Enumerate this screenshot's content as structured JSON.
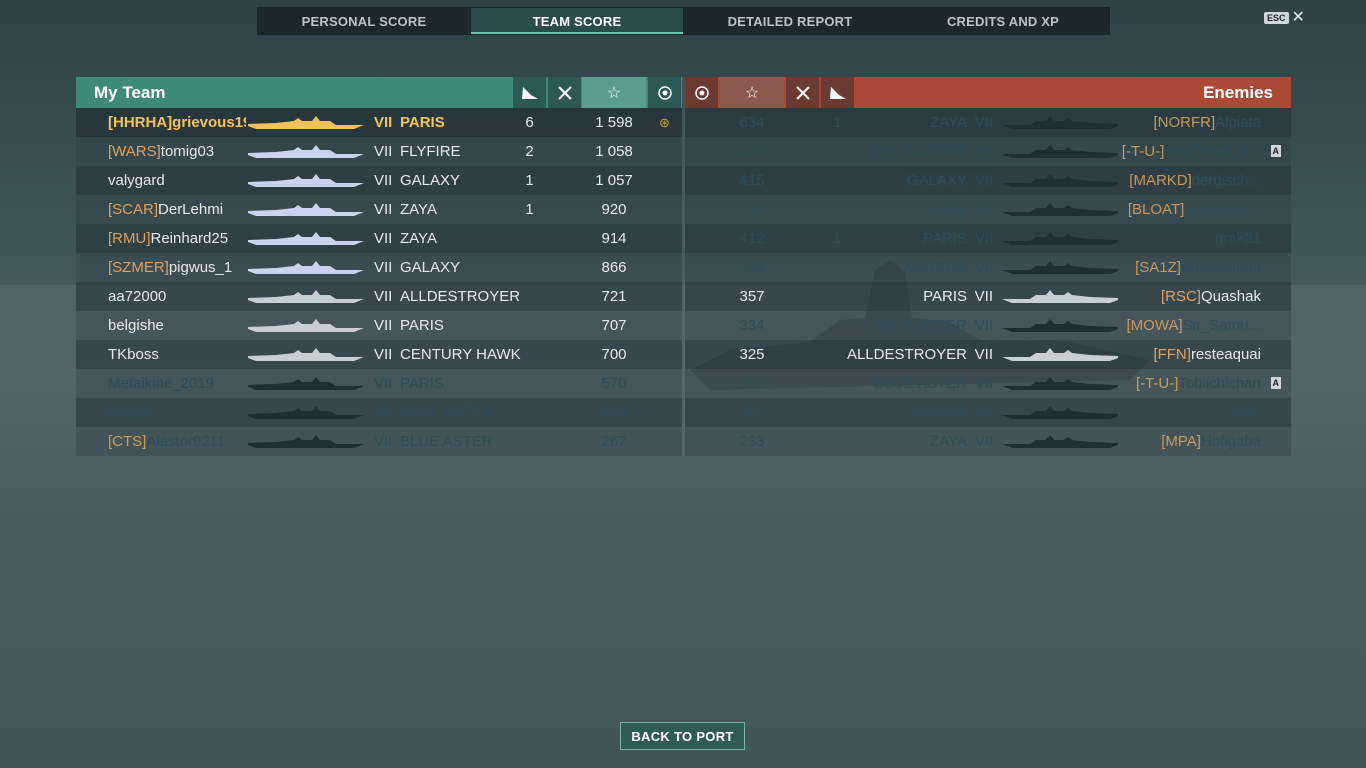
{
  "tabs": [
    "PERSONAL SCORE",
    "TEAM SCORE",
    "DETAILED REPORT",
    "CREDITS AND XP"
  ],
  "active_tab": 1,
  "esc_label": "ESC",
  "my_team": {
    "title": "My Team",
    "players": [
      {
        "clan": "[HHRHA]",
        "name": "grievous19...",
        "tier": "VII",
        "ship": "PARIS",
        "kills": "6",
        "exp": "1 598",
        "me": true
      },
      {
        "clan": "[WARS]",
        "name": "tomig03",
        "tier": "VII",
        "ship": "FLYFIRE",
        "kills": "2",
        "exp": "1 058"
      },
      {
        "clan": "",
        "name": "valygard",
        "tier": "VII",
        "ship": "GALAXY",
        "kills": "1",
        "exp": "1 057"
      },
      {
        "clan": "[SCAR]",
        "name": "DerLehmi",
        "tier": "VII",
        "ship": "ZAYA",
        "kills": "1",
        "exp": "920"
      },
      {
        "clan": "[RMU]",
        "name": "Reinhard25",
        "tier": "VII",
        "ship": "ZAYA",
        "kills": "",
        "exp": "914"
      },
      {
        "clan": "[SZMER]",
        "name": "pigwus_1",
        "tier": "VII",
        "ship": "GALAXY",
        "kills": "",
        "exp": "866"
      },
      {
        "clan": "",
        "name": "aa72000",
        "tier": "VII",
        "ship": "ALLDESTROYER",
        "kills": "",
        "exp": "721"
      },
      {
        "clan": "",
        "name": "belgishe",
        "tier": "VII",
        "ship": "PARIS",
        "kills": "",
        "exp": "707"
      },
      {
        "clan": "",
        "name": "TKboss",
        "tier": "VII",
        "ship": "CENTURY HAWK",
        "kills": "",
        "exp": "700"
      },
      {
        "clan": "",
        "name": "Metalkine_2019",
        "tier": "VII",
        "ship": "PARIS",
        "kills": "",
        "exp": "570",
        "dead": true
      },
      {
        "clan": "",
        "name": "Ptikipik",
        "tier": "VII",
        "ship": "BLUE ASTER",
        "kills": "",
        "exp": "403",
        "dead": true
      },
      {
        "clan": "[CTS]",
        "name": "Alastor9211",
        "tier": "VII",
        "ship": "BLUE ASTER",
        "kills": "",
        "exp": "267",
        "dead": true
      }
    ]
  },
  "enemies": {
    "title": "Enemies",
    "players": [
      {
        "exp": "634",
        "kills": "1",
        "ship": "ZAYA",
        "tier": "VII",
        "clan": "[NORFR]",
        "name": "Alpiata",
        "dead": true
      },
      {
        "exp": "460",
        "kills": "1",
        "ship": "BLUE ASTER",
        "tier": "VII",
        "clan": "[-T-U-]",
        "name": "BoyOfHell_1...",
        "dead": true,
        "badge": "A"
      },
      {
        "exp": "415",
        "kills": "",
        "ship": "GALAXY",
        "tier": "VII",
        "clan": "[MARKD]",
        "name": "dergisch...",
        "dead": true
      },
      {
        "exp": "414",
        "kills": "",
        "ship": "PARIS",
        "tier": "VII",
        "clan": "[BLOAT]",
        "name": "Supersho...",
        "dead": true
      },
      {
        "exp": "412",
        "kills": "1",
        "ship": "PARIS",
        "tier": "VII",
        "clan": "",
        "name": "grak21",
        "dead": true
      },
      {
        "exp": "405",
        "kills": "",
        "ship": "AURORA",
        "tier": "VII",
        "clan": "[SA1Z]",
        "name": "Knuddelfant",
        "dead": true
      },
      {
        "exp": "357",
        "kills": "",
        "ship": "PARIS",
        "tier": "VII",
        "clan": "[RSC]",
        "name": "Quashak"
      },
      {
        "exp": "334",
        "kills": "",
        "ship": "BLUE ASTER",
        "tier": "VII",
        "clan": "[MOWA]",
        "name": "Sir_Samu...",
        "dead": true
      },
      {
        "exp": "325",
        "kills": "",
        "ship": "ALLDESTROYER",
        "tier": "VII",
        "clan": "[FFN]",
        "name": "resteaquai"
      },
      {
        "exp": "301",
        "kills": "",
        "ship": "BLUE ASTER",
        "tier": "VII",
        "clan": "[-T-U-]",
        "name": "Tobiichichan",
        "dead": true,
        "badge": "A"
      },
      {
        "exp": "267",
        "kills": "",
        "ship": "NORMA",
        "tier": "VII",
        "clan": "",
        "name": "n3lix",
        "dead": true
      },
      {
        "exp": "233",
        "kills": "",
        "ship": "ZAYA",
        "tier": "VII",
        "clan": "[MPA]",
        "name": "Hofigaba",
        "dead": true
      }
    ]
  },
  "back_button": "BACK TO PORT",
  "colors": {
    "my_team": "#3c8a77",
    "enemies": "#a94a36",
    "clan": "#e0a060",
    "self": "#f3c25a",
    "dead": "#2d4d5c"
  }
}
